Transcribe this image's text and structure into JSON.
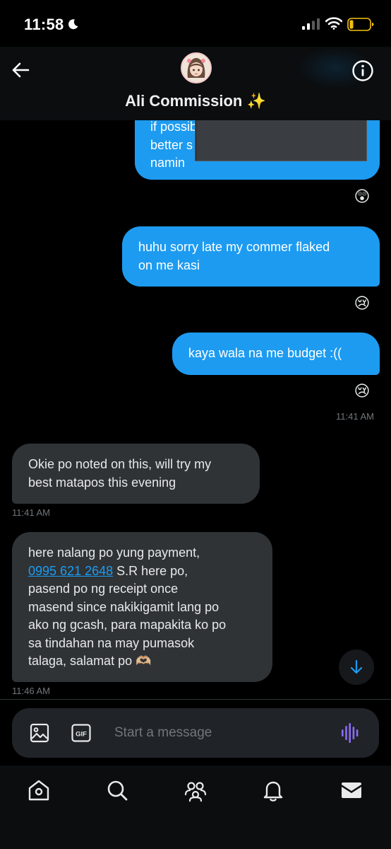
{
  "status_bar": {
    "time": "11:58"
  },
  "header": {
    "title": "Ali Commission ✨"
  },
  "messages": [
    {
      "id": "m1",
      "side": "sent",
      "text": "if possible po by tonight even\nbetter s\nnamin",
      "reaction": "😲"
    },
    {
      "id": "m2",
      "side": "sent",
      "text": "huhu sorry late my commer flaked\non me kasi",
      "reaction": "😢"
    },
    {
      "id": "m3",
      "side": "sent",
      "text": "kaya wala na me budget :((",
      "reaction": "😢",
      "time": "11:41 AM"
    },
    {
      "id": "m4",
      "side": "received",
      "text": "Okie po noted on this, will try my\nbest matapos this evening",
      "time": "11:41 AM"
    },
    {
      "id": "m5",
      "side": "received",
      "text_before": "here nalang po yung payment,\n",
      "phone": "0995 621 2648",
      "text_after": " S.R here po,\npasend po ng receipt once\nmasend since nakikigamit lang po\nako ng gcash, para mapakita ko po\nsa tindahan na may pumasok\ntalaga, salamat po 🫶🏼",
      "time": "11:46 AM"
    }
  ],
  "composer": {
    "placeholder": "Start a message"
  },
  "tabs": [
    "home",
    "search",
    "communities",
    "notifications",
    "messages"
  ],
  "colors": {
    "accent": "#1d9bf0",
    "received_bubble": "#2f3336",
    "background": "#000000"
  },
  "icons": [
    "moon-icon",
    "signal-icon",
    "wifi-icon",
    "battery-icon",
    "back-arrow-icon",
    "info-icon",
    "image-icon",
    "gif-icon",
    "voice-icon",
    "arrow-down-icon",
    "home-icon",
    "search-icon",
    "communities-icon",
    "bell-icon",
    "mail-icon"
  ]
}
